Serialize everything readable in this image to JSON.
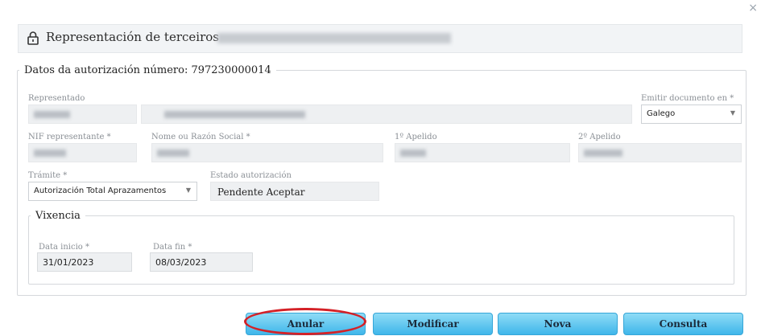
{
  "dialog": {
    "title": "Representación de terceiros",
    "close_label": "×"
  },
  "auth_section": {
    "legend": "Datos da autorización número: 797230000014",
    "representado_label": "Representado",
    "emitir_label": "Emitir documento en *",
    "emitir_value": "Galego",
    "nif_label": "NIF representante *",
    "nome_label": "Nome ou Razón Social *",
    "apelido1_label": "1º Apelido",
    "apelido2_label": "2º Apelido",
    "tramite_label": "Trámite *",
    "tramite_value": "Autorización Total Aprazamentos",
    "estado_label": "Estado autorización",
    "estado_value": "Pendente Aceptar"
  },
  "vixencia": {
    "legend": "Vixencia",
    "inicio_label": "Data inicio *",
    "inicio_value": "31/01/2023",
    "fin_label": "Data fin *",
    "fin_value": "08/03/2023"
  },
  "buttons": {
    "anular": "Anular",
    "modificar": "Modificar",
    "nova": "Nova",
    "consulta": "Consulta"
  },
  "icons": {
    "lock": "lock-icon",
    "close": "close-icon",
    "caret": "chevron-down-icon"
  },
  "colors": {
    "button_gradient_top": "#8fdcf6",
    "button_gradient_bottom": "#3fb6ea",
    "highlight_ring": "#d42127"
  }
}
